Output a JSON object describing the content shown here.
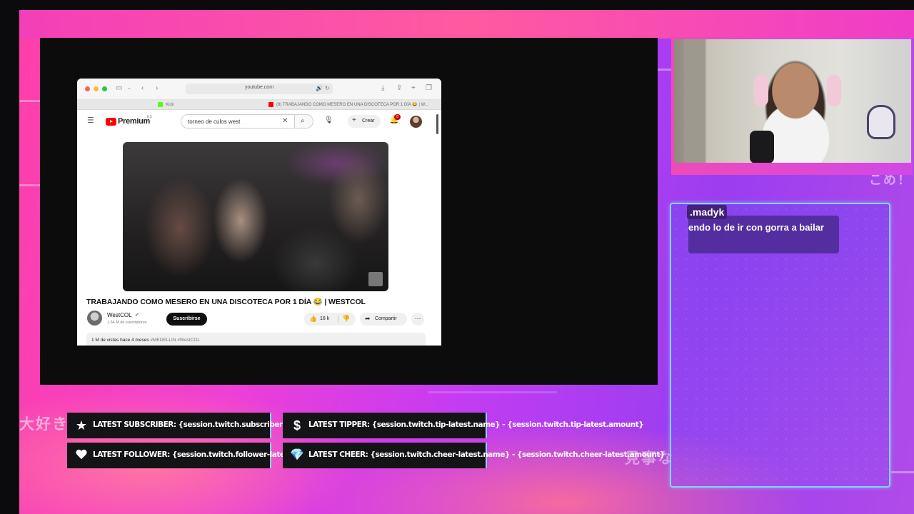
{
  "browser": {
    "url": "youtube.com",
    "tabs": [
      {
        "label": "Kick",
        "icon": "kick-favicon"
      },
      {
        "label": "(8) TRABAJANDO COMO MESERO EN UNA DISCOTECA POR 1 DÍA 😂 | W...",
        "icon": "youtube-favicon"
      }
    ]
  },
  "youtube": {
    "logo": "Premium",
    "region": "ES",
    "search_query": "torneo de culos west",
    "create_label": "Crear",
    "notification_count": "8",
    "video_title": "TRABAJANDO COMO MESERO EN UNA DISCOTECA POR 1 DÍA 😂 | WESTCOL",
    "channel_name": "WestCOL",
    "subscribers": "1.54 M de suscriptores",
    "subscribe_label": "Suscribirse",
    "likes": "16 k",
    "share_label": "Compartir",
    "views": "1 M de vistas",
    "published": "hace 4 meses",
    "hashtags": "#MEDELLIN #WestCOL"
  },
  "chat": {
    "username": ".madyk",
    "message": "endo lo de ir con gorra a bailar"
  },
  "alerts": {
    "subscriber": "LATEST SUBSCRIBER: {session.twitch.subscriber-latest.name}",
    "tipper": "LATEST TIPPER: {session.twitch.tip-latest.name} - {session.twitch.tip-latest.amount}",
    "follower": "LATEST FOLLOWER: {session.twitch.follower-latest.name}",
    "cheer": "LATEST CHEER: {session.twitch.cheer-latest.name} - {session.twitch.cheer-latest.amount}"
  },
  "decor": {
    "jp_left": "大好き",
    "jp_top_right": "こめ！",
    "jp_bottom_right": "見事な"
  },
  "colors": {
    "overlay_pink": "#ff3fa8",
    "overlay_purple": "#9a3ef0",
    "chat_border": "#7fd6ff",
    "youtube_red": "#ff0000"
  }
}
